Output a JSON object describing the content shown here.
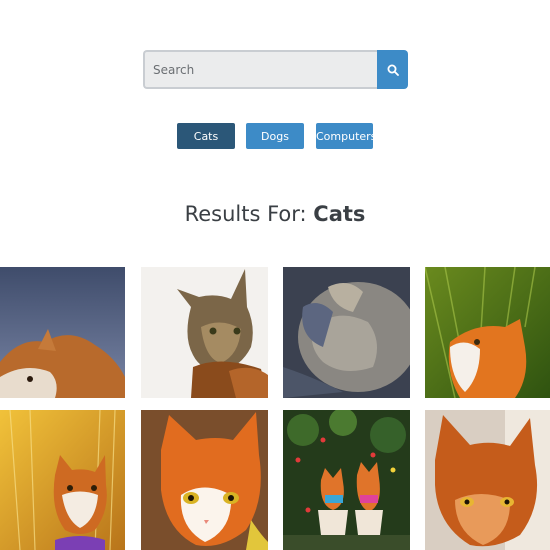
{
  "search": {
    "placeholder": "Search",
    "value": "",
    "button_icon": "search-icon"
  },
  "categories": [
    {
      "label": "Cats",
      "active": true
    },
    {
      "label": "Dogs",
      "active": false
    },
    {
      "label": "Computers",
      "active": false
    }
  ],
  "results": {
    "prefix": "Results For: ",
    "query": "Cats"
  },
  "images": [
    {
      "name": "cat-photo-1"
    },
    {
      "name": "cat-photo-2"
    },
    {
      "name": "cat-photo-3"
    },
    {
      "name": "cat-photo-4"
    },
    {
      "name": "cat-photo-5"
    },
    {
      "name": "cat-photo-6"
    },
    {
      "name": "cat-photo-7"
    },
    {
      "name": "cat-photo-8"
    }
  ],
  "colors": {
    "accent": "#3d8bc7",
    "active_category": "#2b5778"
  }
}
